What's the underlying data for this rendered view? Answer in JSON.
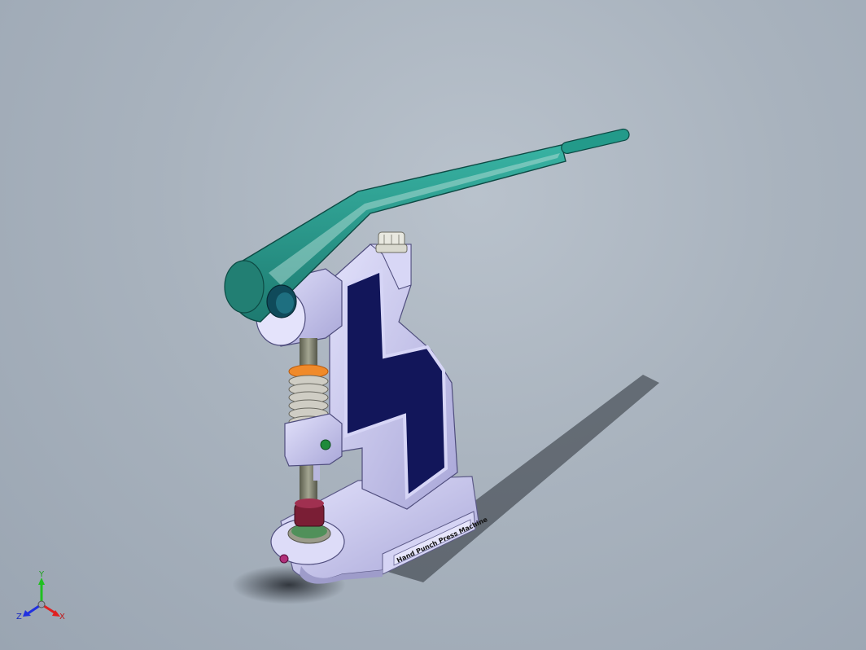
{
  "model": {
    "nameplate_text": "Hand Punch Press Machine"
  },
  "triad": {
    "axis_x_label": "X",
    "axis_y_label": "Y",
    "axis_z_label": "Z"
  },
  "colors": {
    "background": "#a9b3be",
    "lever": "#2a9a8c",
    "frame": "#c9c8f0",
    "frame_inset": "#12165a",
    "spring": "#c8c6c0",
    "spring_ring": "#f08a2a",
    "shaft": "#7e8070",
    "die_collar": "#7a1e35",
    "axis_x": "#e02020",
    "axis_y": "#20c020",
    "axis_z": "#2030e0"
  }
}
